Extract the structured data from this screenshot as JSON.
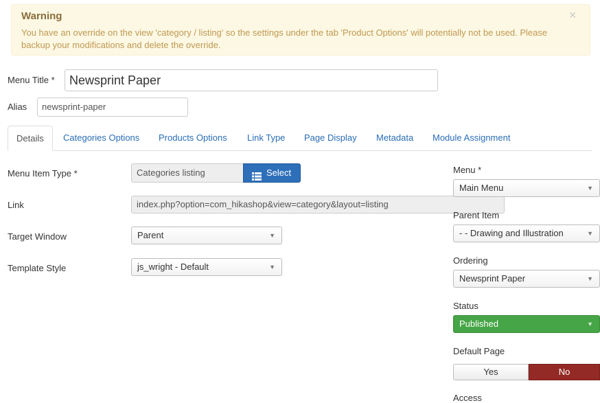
{
  "alert": {
    "title": "Warning",
    "message": "You have an override on the view 'category / listing' so the settings under the tab 'Product Options' will potentially not be used. Please backup your modifications and delete the override.",
    "close": "×"
  },
  "form": {
    "menu_title_label": "Menu Title *",
    "menu_title_value": "Newsprint Paper",
    "alias_label": "Alias",
    "alias_value": "newsprint-paper"
  },
  "tabs": [
    {
      "label": "Details",
      "active": true
    },
    {
      "label": "Categories Options"
    },
    {
      "label": "Products Options"
    },
    {
      "label": "Link Type"
    },
    {
      "label": "Page Display"
    },
    {
      "label": "Metadata"
    },
    {
      "label": "Module Assignment"
    }
  ],
  "details": {
    "menu_item_type_label": "Menu Item Type *",
    "menu_item_type_value": "Categories listing",
    "select_button": "Select",
    "link_label": "Link",
    "link_value": "index.php?option=com_hikashop&view=category&layout=listing",
    "target_window_label": "Target Window",
    "target_window_value": "Parent",
    "template_style_label": "Template Style",
    "template_style_value": "js_wright - Default"
  },
  "sidebar": {
    "menu_label": "Menu *",
    "menu_value": "Main Menu",
    "parent_item_label": "Parent Item",
    "parent_item_value": "- - Drawing and Illustration",
    "ordering_label": "Ordering",
    "ordering_value": "Newsprint Paper",
    "status_label": "Status",
    "status_value": "Published",
    "default_page_label": "Default Page",
    "default_page_yes": "Yes",
    "default_page_no": "No",
    "access_label": "Access"
  },
  "colors": {
    "alert_bg": "#fcf8e3",
    "tab_link": "#2a6db5",
    "select_button": "#2e6fba",
    "status_published": "#46a546",
    "default_no": "#942a25"
  },
  "icons": {
    "select_icon": "list-icon",
    "caret": "caret-down-icon",
    "close": "close-icon"
  }
}
